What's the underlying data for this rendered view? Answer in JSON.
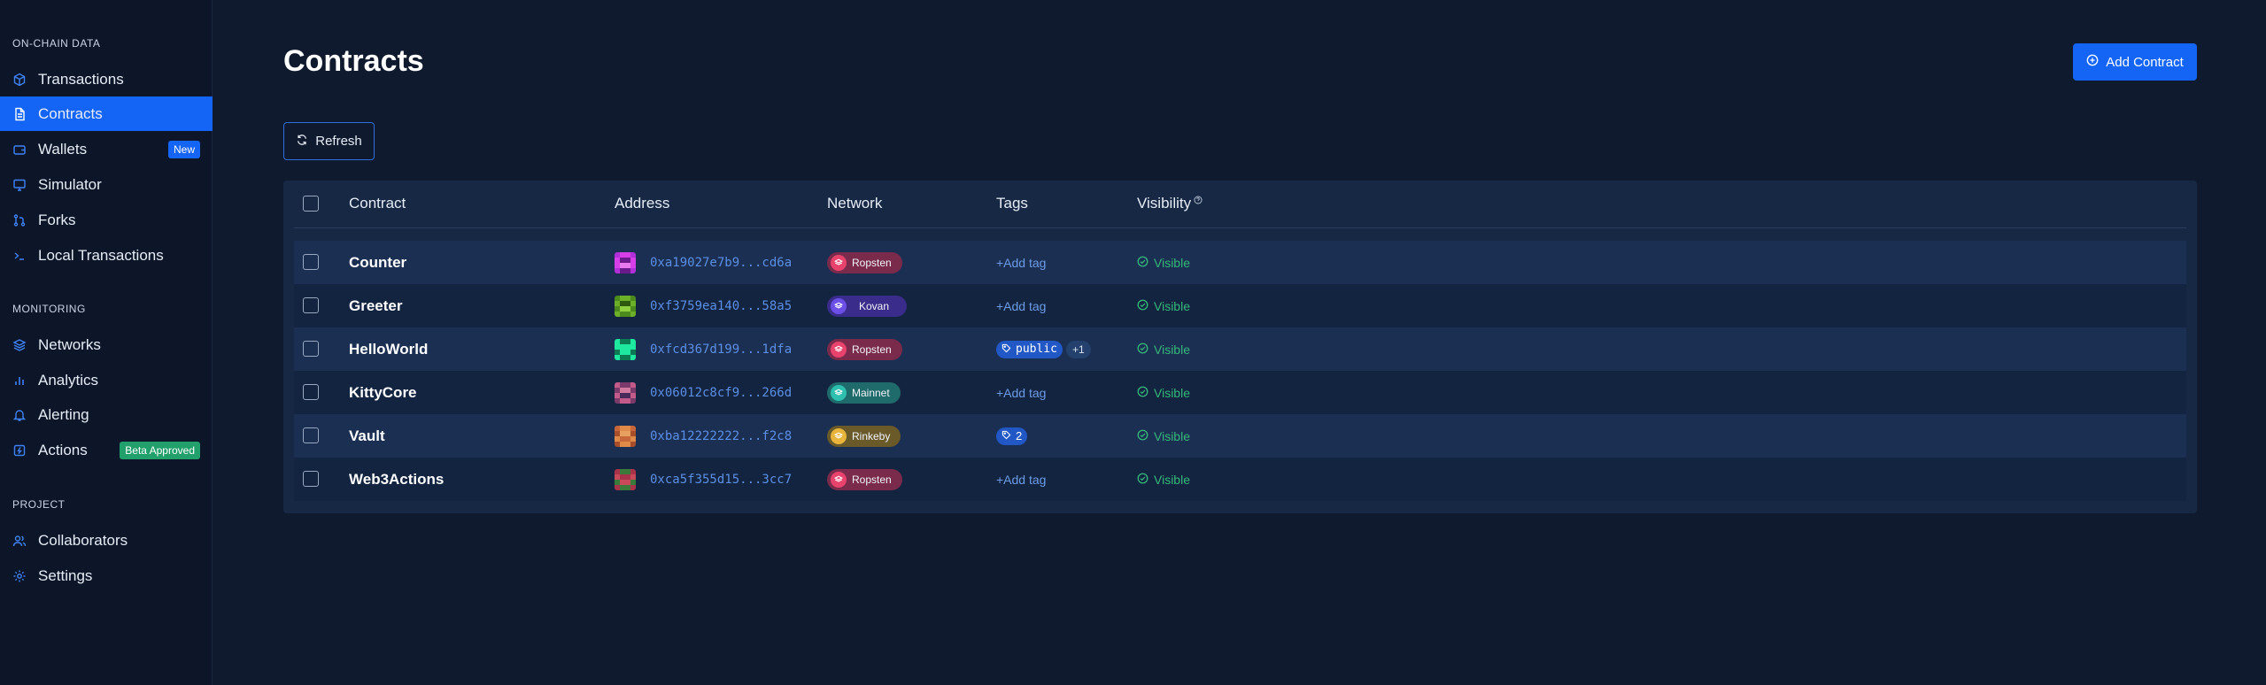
{
  "sidebar": {
    "sections": [
      {
        "title": "ON-CHAIN DATA"
      },
      {
        "title": "MONITORING"
      },
      {
        "title": "PROJECT"
      }
    ],
    "items": [
      {
        "label": "Transactions",
        "icon": "cube-icon"
      },
      {
        "label": "Contracts",
        "icon": "document-icon",
        "active": true
      },
      {
        "label": "Wallets",
        "icon": "wallet-icon",
        "badge": "New"
      },
      {
        "label": "Simulator",
        "icon": "monitor-icon"
      },
      {
        "label": "Forks",
        "icon": "fork-icon"
      },
      {
        "label": "Local Transactions",
        "icon": "terminal-icon"
      },
      {
        "label": "Networks",
        "icon": "layers-icon"
      },
      {
        "label": "Analytics",
        "icon": "bar-chart-icon"
      },
      {
        "label": "Alerting",
        "icon": "bell-icon"
      },
      {
        "label": "Actions",
        "icon": "lightning-icon",
        "badge": "Beta Approved"
      },
      {
        "label": "Collaborators",
        "icon": "users-icon"
      },
      {
        "label": "Settings",
        "icon": "gear-icon"
      }
    ]
  },
  "header": {
    "title": "Contracts",
    "add_button": "Add Contract",
    "refresh_button": "Refresh"
  },
  "table": {
    "columns": [
      "Contract",
      "Address",
      "Network",
      "Tags",
      "Visibility"
    ],
    "rows": [
      {
        "name": "Counter",
        "address": "0xa19027e7b9...cd6a",
        "network": "Ropsten",
        "tags_label": "+Add tag",
        "visibility": "Visible"
      },
      {
        "name": "Greeter",
        "address": "0xf3759ea140...58a5",
        "network": "Kovan",
        "tags_label": "+Add tag",
        "visibility": "Visible"
      },
      {
        "name": "HelloWorld",
        "address": "0xfcd367d199...1dfa",
        "network": "Ropsten",
        "tag": "public",
        "tag_count": "+1",
        "visibility": "Visible"
      },
      {
        "name": "KittyCore",
        "address": "0x06012c8cf9...266d",
        "network": "Mainnet",
        "tags_label": "+Add tag",
        "visibility": "Visible"
      },
      {
        "name": "Vault",
        "address": "0xba12222222...f2c8",
        "network": "Rinkeby",
        "tag_number": "2",
        "visibility": "Visible"
      },
      {
        "name": "Web3Actions",
        "address": "0xca5f355d15...3cc7",
        "network": "Ropsten",
        "tags_label": "+Add tag",
        "visibility": "Visible"
      }
    ]
  },
  "colors": {
    "accent": "#1464f6",
    "ropsten": "#e8436d",
    "kovan": "#6b4fe6",
    "mainnet": "#2ebfae",
    "rinkeby": "#e8b43c",
    "visible": "#35b87a"
  }
}
